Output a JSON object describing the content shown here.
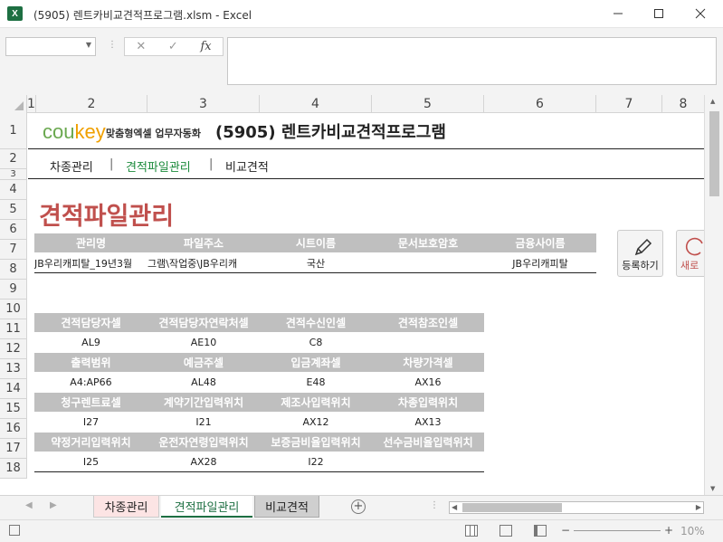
{
  "window": {
    "title": "(5905) 렌트카비교견적프로그램.xlsm - Excel",
    "app_icon": "X"
  },
  "formula_bar": {
    "fx_label": "fx",
    "cancel_label": "✕",
    "enter_label": "✓"
  },
  "columns": [
    "1",
    "2",
    "3",
    "4",
    "5",
    "6",
    "7",
    "8"
  ],
  "rows": [
    "1",
    "2",
    "3",
    "4",
    "5",
    "6",
    "7",
    "8",
    "9",
    "10",
    "11",
    "12",
    "13",
    "14",
    "15",
    "16",
    "17",
    "18"
  ],
  "header": {
    "logo_main": "cou",
    "logo_accent": "key",
    "logo_sub": "맞춤형엑셀 업무자동화",
    "title": "(5905) 렌트카비교견적프로그램"
  },
  "nav": {
    "items": [
      "차종관리",
      "견적파일관리",
      "비교견적"
    ],
    "sep": "|",
    "active_index": 1
  },
  "page_title": "견적파일관리",
  "file_table": {
    "headers": [
      "관리명",
      "파일주소",
      "시트이름",
      "문서보호암호",
      "금융사이름"
    ],
    "row": [
      "JB우리캐피탈_19년3월",
      "그램\\작업중\\JB우리캐",
      "국산",
      "",
      "JB우리캐피탈"
    ]
  },
  "settings": {
    "blocks": [
      {
        "headers": [
          "견적담당자셀",
          "견적담당자연락처셀",
          "견적수신인셀",
          "견적참조인셀"
        ],
        "values": [
          "AL9",
          "AE10",
          "C8",
          ""
        ]
      },
      {
        "headers": [
          "출력범위",
          "예금주셀",
          "입금계좌셀",
          "차량가격셀"
        ],
        "values": [
          "A4:AP66",
          "AL48",
          "E48",
          "AX16"
        ]
      },
      {
        "headers": [
          "청구렌트료셀",
          "계약기간입력위치",
          "제조사입력위치",
          "차종입력위치"
        ],
        "values": [
          "I27",
          "I21",
          "AX12",
          "AX13"
        ]
      },
      {
        "headers": [
          "약정거리입력위치",
          "운전자연령입력위치",
          "보증금비율입력위치",
          "선수금비율입력위치"
        ],
        "values": [
          "I25",
          "AX28",
          "I22",
          ""
        ]
      }
    ]
  },
  "buttons": {
    "register": "등록하기",
    "new": "새로"
  },
  "sheet_tabs": [
    "차종관리",
    "견적파일관리",
    "비교견적"
  ],
  "sheet_tab_active": 1,
  "status": {
    "zoom": "10%",
    "zoom_minus": "−",
    "zoom_plus": "+"
  },
  "colors": {
    "accent": "#1d6f42",
    "title_red": "#c0504d",
    "nav_active": "#1c8b3c",
    "table_header": "#bfbfbf",
    "tab_pink": "#fce4e4"
  }
}
